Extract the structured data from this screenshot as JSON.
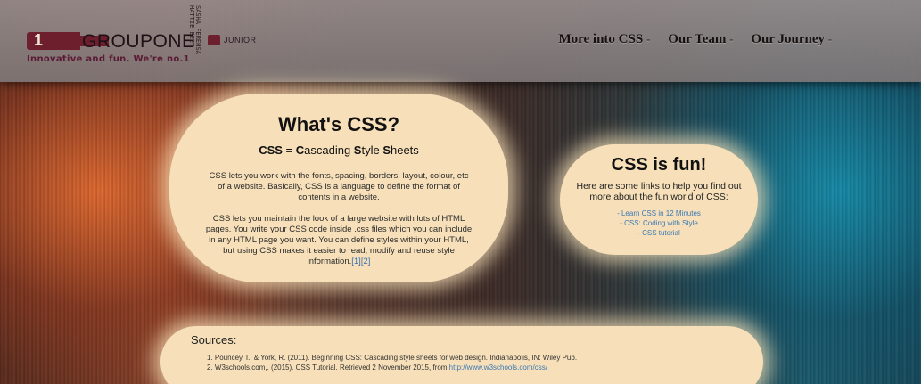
{
  "header": {
    "logo": {
      "one": "1",
      "brand": "GROUPONE",
      "junior": "JUNIOR",
      "spine": "SASHA FEREHSA HATTIE BEET"
    },
    "tagline": "Innovative and fun. We're no.1",
    "nav": [
      {
        "label": "More into CSS",
        "caret": "-"
      },
      {
        "label": "Our Team",
        "caret": "-"
      },
      {
        "label": "Our Journey",
        "caret": "-"
      }
    ]
  },
  "main": {
    "title": "What's CSS?",
    "subtitle": {
      "css": "CSS",
      "equals": " = ",
      "c1": "C",
      "w1": "ascading ",
      "s1": "S",
      "w2": "tyle ",
      "s2": "S",
      "w3": "heets"
    },
    "para1": "CSS lets you work with the fonts, spacing, borders, layout, colour, etc of a website. Basically, CSS is a language to define the format of contents in a website.",
    "para2": "CSS lets you maintain the look of a large website with lots of HTML pages. You write your CSS code inside .css files which you can include in any HTML page you want. You can define styles within your HTML, but using CSS makes it easier to read, modify and reuse style information.",
    "cite1": "[1]",
    "cite2": "[2]"
  },
  "fun": {
    "title": "CSS is fun!",
    "text": "Here are some links to help you find out more about the fun world of CSS:",
    "links": [
      "- Learn CSS in 12 Minutes",
      "- CSS: Coding with Style",
      "- CSS tutorial"
    ]
  },
  "sources": {
    "title": "Sources:",
    "items": [
      {
        "text": "1. Pouncey, I., & York, R. (2011). Beginning CSS: Cascading style sheets for web design. Indianapolis, IN: Wiley Pub."
      },
      {
        "text": "2. W3schools.com,. (2015). CSS Tutorial. Retrieved 2 November 2015, from ",
        "link": "http://www.w3schools.com/css/"
      }
    ]
  }
}
